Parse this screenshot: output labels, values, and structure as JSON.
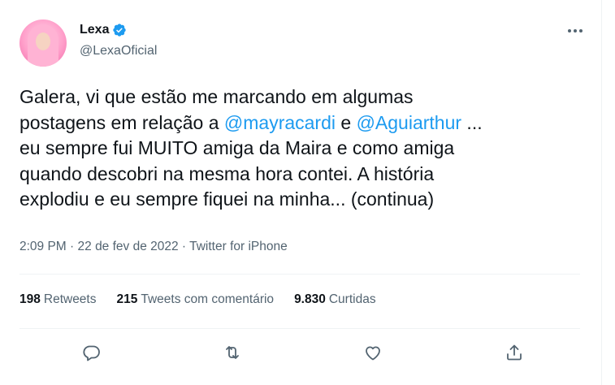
{
  "author": {
    "name": "Lexa",
    "handle": "@LexaOficial"
  },
  "tweet": {
    "text_parts": [
      "Galera, vi que estão me marcando em algumas\npostagens em relação a ",
      "@mayracardi",
      " e ",
      "@Aguiarthur",
      " ...\neu sempre fui MUITO amiga da Maira e como amiga\nquando descobri na mesma hora contei. A história\nexplodiu e eu sempre fiquei na minha... (continua)"
    ]
  },
  "meta": {
    "time": "2:09 PM",
    "separator": " · ",
    "date": "22 de fev de 2022",
    "source": "Twitter for iPhone"
  },
  "stats": {
    "retweets_count": "198",
    "retweets_label": "Retweets",
    "quotes_count": "215",
    "quotes_label": "Tweets com comentário",
    "likes_count": "9.830",
    "likes_label": "Curtidas"
  },
  "colors": {
    "accent": "#1d9bf0",
    "text": "#0f1419",
    "secondary": "#536471",
    "divider": "#eff3f4"
  },
  "icons": [
    "verified-badge-icon",
    "more-options-icon",
    "reply-icon",
    "retweet-icon",
    "like-icon",
    "share-icon"
  ]
}
